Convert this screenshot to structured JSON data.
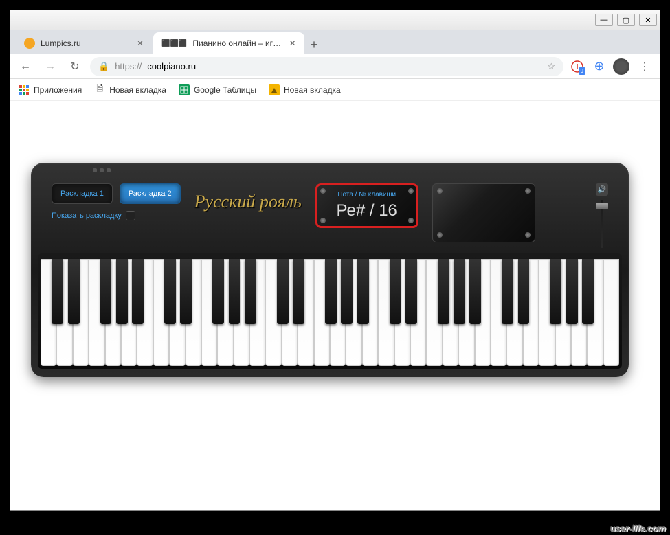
{
  "window": {
    "minimize": "—",
    "maximize": "▢",
    "close": "✕"
  },
  "tabs": [
    {
      "title": "Lumpics.ru",
      "icon_color": "#f5a623",
      "active": false
    },
    {
      "title": "Пианино онлайн – играть на кл",
      "icon": "⬛",
      "active": true
    }
  ],
  "toolbar": {
    "back": "←",
    "forward": "→",
    "reload": "↻",
    "url_prefix": "https://",
    "url_domain": "coolpiano.ru",
    "star": "☆",
    "ext_badge": "9",
    "globe": "⊕",
    "menu": "⋮"
  },
  "bookmarks": [
    {
      "icon": "⊞",
      "icon_color": "#555",
      "label": "Приложения"
    },
    {
      "icon": "🗎",
      "icon_color": "#888",
      "label": "Новая вкладка"
    },
    {
      "icon": "▦",
      "icon_color": "#0f9d58",
      "label": "Google Таблицы"
    },
    {
      "icon": "▣",
      "icon_color": "#f4b400",
      "label": "Новая вкладка"
    }
  ],
  "piano": {
    "layout1": "Раскладка 1",
    "layout2": "Раскладка 2",
    "show_layout": "Показать раскладку",
    "brand": "Русский рояль",
    "display_label": "Нота / № клавиши",
    "display_value": "Ре# / 16",
    "volume_icon": "🔊"
  },
  "watermark": "user-life.com",
  "keyboard": {
    "white_count": 36,
    "black_positions": [
      0.7,
      1.7,
      3.7,
      4.7,
      5.7,
      7.7,
      8.7,
      10.7,
      11.7,
      12.7,
      14.7,
      15.7,
      17.7,
      18.7,
      19.7,
      21.7,
      22.7,
      24.7,
      25.7,
      26.7,
      28.7,
      29.7,
      31.7,
      32.7,
      33.7
    ]
  }
}
